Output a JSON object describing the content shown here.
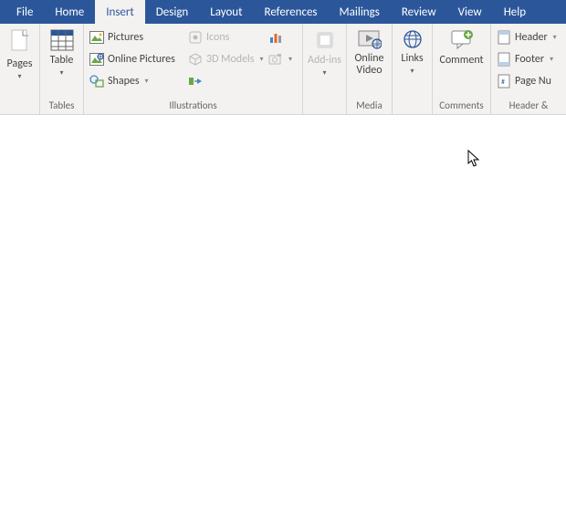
{
  "menu": {
    "file": "File",
    "home": "Home",
    "insert": "Insert",
    "design": "Design",
    "layout": "Layout",
    "references": "References",
    "mailings": "Mailings",
    "review": "Review",
    "view": "View",
    "help": "Help",
    "active": "insert"
  },
  "ribbon": {
    "pages": {
      "label": "Pages"
    },
    "tables": {
      "button": "Table",
      "group": "Tables"
    },
    "illustrations": {
      "pictures": "Pictures",
      "online_pictures": "Online Pictures",
      "shapes": "Shapes",
      "icons": "Icons",
      "models": "3D Models",
      "group": "Illustrations"
    },
    "addins": {
      "button": "Add-ins"
    },
    "media": {
      "button": "Online Video",
      "group": "Media"
    },
    "links": {
      "button": "Links"
    },
    "comments": {
      "button": "Comment",
      "group": "Comments"
    },
    "headerfooter": {
      "header": "Header",
      "footer": "Footer",
      "page_number": "Page Nu",
      "group": "Header &"
    }
  }
}
